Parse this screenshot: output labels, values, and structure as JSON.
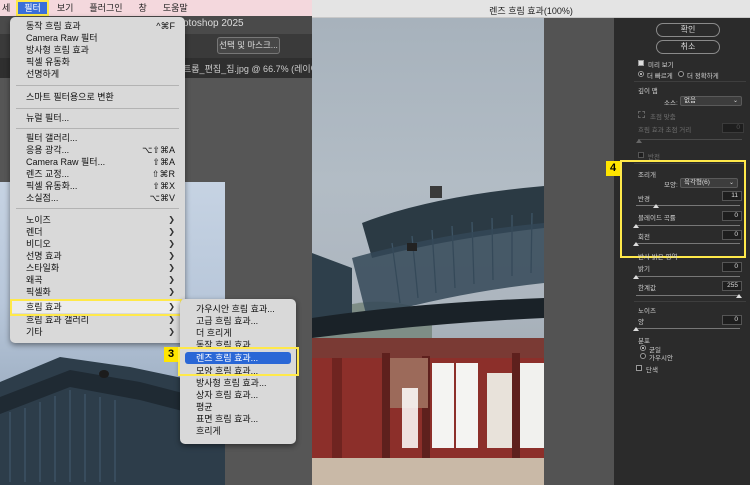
{
  "menubar": {
    "items": [
      {
        "label": "세"
      },
      {
        "label": "필터"
      },
      {
        "label": "보기"
      },
      {
        "label": "플러그인"
      },
      {
        "label": "창"
      },
      {
        "label": "도움말"
      }
    ]
  },
  "app": {
    "title": "otoshop 2025",
    "select_mask_label": "선택 및 마스크...",
    "doc_tab": "트롬_편집_집.jpg @ 66.7% (레이어 0"
  },
  "filter_menu": {
    "items": [
      {
        "label": "동작 흐림 효과",
        "shortcut": "^⌘F"
      },
      {
        "label": "Camera Raw 필터"
      },
      {
        "label": "방사형 흐림 효과"
      },
      {
        "label": "픽셀 유동화"
      },
      {
        "label": "선명하게"
      },
      {
        "label": "스마트 필터용으로 변환"
      },
      {
        "label": "뉴럴 필터..."
      },
      {
        "label": "필터 갤러리..."
      },
      {
        "label": "응용 광각...",
        "shortcut": "⌥⇧⌘A"
      },
      {
        "label": "Camera Raw 필터...",
        "shortcut": "⇧⌘A"
      },
      {
        "label": "렌즈 교정...",
        "shortcut": "⇧⌘R"
      },
      {
        "label": "픽셀 유동화...",
        "shortcut": "⇧⌘X"
      },
      {
        "label": "소실점...",
        "shortcut": "⌥⌘V"
      },
      {
        "label": "노이즈"
      },
      {
        "label": "렌더"
      },
      {
        "label": "비디오"
      },
      {
        "label": "선명 효과"
      },
      {
        "label": "스타일화"
      },
      {
        "label": "왜곡"
      },
      {
        "label": "픽셀화"
      },
      {
        "label": "흐림 효과"
      },
      {
        "label": "흐림 효과 갤러리"
      },
      {
        "label": "기타"
      }
    ]
  },
  "blur_menu": {
    "items": [
      {
        "label": "가우시안 흐림 효과..."
      },
      {
        "label": "고급 흐림 효과..."
      },
      {
        "label": "더 흐리게"
      },
      {
        "label": "동작 흐림 효과..."
      },
      {
        "label": "렌즈 흐림 효과..."
      },
      {
        "label": "모양 흐림 효과..."
      },
      {
        "label": "방사형 흐림 효과..."
      },
      {
        "label": "상자 흐림 효과..."
      },
      {
        "label": "평균"
      },
      {
        "label": "표면 흐림 효과..."
      },
      {
        "label": "흐리게"
      }
    ]
  },
  "badges": {
    "step3": "3",
    "step4": "4"
  },
  "dialog": {
    "title": "렌즈 흐림 효과(100%)",
    "ok_label": "확인",
    "cancel_label": "취소",
    "preview_label": "미리 보기",
    "faster_label": "더 빠르게",
    "more_accurate_label": "더 정확하게",
    "depth_map_label": "깊이 맵",
    "source_label": "소스:",
    "source_value": "없음",
    "focal_point_label": "초점 맞춤",
    "blur_focal_distance_label": "흐림 효과 초점 거리",
    "blur_focal_distance_value": "0",
    "invert_label": "반전",
    "iris_label": "조리개",
    "shape_label": "모양:",
    "shape_value": "육각형(6)",
    "radius_label": "반경",
    "radius_value": "11",
    "blade_curvature_label": "블레이드 곡률",
    "blade_curvature_value": "0",
    "rotation_label": "회전",
    "rotation_value": "0",
    "specular_label": "반사 밝은 영역",
    "brightness_label": "밝기",
    "brightness_value": "0",
    "threshold_label": "한계값",
    "threshold_value": "255",
    "noise_label": "노이즈",
    "amount_label": "양",
    "amount_value": "0",
    "distribution_label": "분포",
    "uniform_label": "균일",
    "gaussian_label": "가우시안",
    "monochromatic_label": "단색"
  }
}
